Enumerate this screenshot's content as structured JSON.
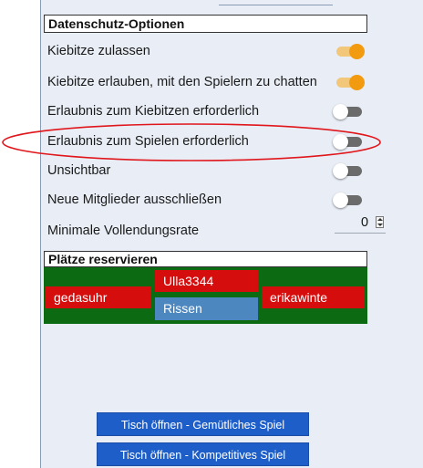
{
  "privacy": {
    "header": "Datenschutz-Optionen",
    "options": [
      {
        "label": "Kiebitze zulassen",
        "state": "on"
      },
      {
        "label": "Kiebitze erlauben, mit den Spielern zu chatten",
        "state": "on"
      },
      {
        "label": "Erlaubnis zum Kiebitzen erforderlich",
        "state": "off"
      },
      {
        "label": "Erlaubnis zum Spielen erforderlich",
        "state": "off"
      },
      {
        "label": "Unsichtbar",
        "state": "off"
      },
      {
        "label": "Neue Mitglieder ausschließen",
        "state": "off"
      }
    ],
    "completion_rate": {
      "label": "Minimale Vollendungsrate",
      "value": "0"
    }
  },
  "seats": {
    "header": "Plätze reservieren",
    "players": {
      "left": "gedasuhr",
      "top": "Ulla3344",
      "bottom": "Rissen",
      "right": "erikawinte"
    }
  },
  "buttons": {
    "casual": "Tisch öffnen - Gemütliches Spiel",
    "competitive": "Tisch öffnen - Kompetitives Spiel"
  },
  "colors": {
    "toggle_on": "#f29b11",
    "seat_red": "#d60d0d",
    "seat_blue": "#4d87bf",
    "seat_area_green": "#0c6a12",
    "button_blue": "#1d5ec9",
    "highlight_ellipse": "#e0161c"
  }
}
